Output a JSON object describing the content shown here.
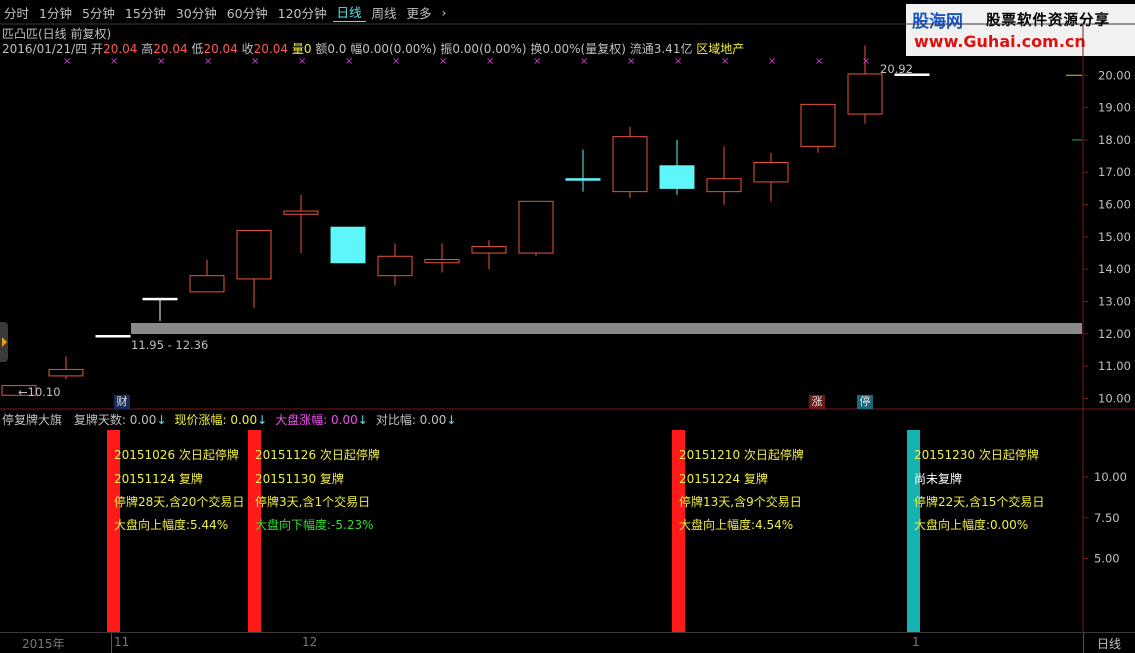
{
  "toolbar": {
    "tabs": [
      "分时",
      "1分钟",
      "5分钟",
      "15分钟",
      "30分钟",
      "60分钟",
      "120分钟",
      "日线",
      "周线",
      "更多"
    ],
    "active": "日线",
    "more_arrow": "›"
  },
  "logo": {
    "brand": "股海网",
    "slogan": "股票软件资源分享",
    "url": "www.Guhai.com.cn"
  },
  "stock": {
    "title": "匹凸匹(日线 前复权)",
    "date": "2016/01/21/四",
    "open_label": "开",
    "open": "20.04",
    "high_label": "高",
    "high": "20.04",
    "low_label": "低",
    "low": "20.04",
    "close_label": "收",
    "close": "20.04",
    "vol_label": "量",
    "vol": "0",
    "amt_label": "额",
    "amt": "0.0",
    "pct_label": "幅",
    "pct": "0.00(0.00%)",
    "amp_label": "振",
    "amp": "0.00(0.00%)",
    "turn_label": "换",
    "turn": "0.00%(量复权)",
    "float_label": "流通",
    "float": "3.41亿",
    "sector": "区域地产"
  },
  "price_axis": [
    "20.00",
    "19.00",
    "18.00",
    "17.00",
    "16.00",
    "15.00",
    "14.00",
    "13.00",
    "12.00",
    "11.00",
    "10.00"
  ],
  "annotations": {
    "low": "←10.10",
    "high": "20.92",
    "range": "11.95 - 12.36",
    "tag_cai": "财",
    "tag_zhang": "涨",
    "tag_ting": "停"
  },
  "chart_data": {
    "type": "candlestick",
    "ylim": [
      9.8,
      21.4
    ],
    "candles": [
      {
        "o": 10.1,
        "h": 10.3,
        "l": 10.1,
        "c": 10.4,
        "color": "#e8533c"
      },
      {
        "o": 10.7,
        "h": 11.3,
        "l": 10.6,
        "c": 10.9,
        "color": "#e8533c"
      },
      {
        "o": 11.95,
        "h": 11.95,
        "l": 11.95,
        "c": 11.95,
        "color": "#ffffff"
      },
      {
        "o": 13.1,
        "h": 13.1,
        "l": 12.4,
        "c": 13.1,
        "color": "#ffffff"
      },
      {
        "o": 13.3,
        "h": 14.3,
        "l": 13.3,
        "c": 13.8,
        "color": "#e8533c"
      },
      {
        "o": 13.7,
        "h": 15.2,
        "l": 12.8,
        "c": 15.2,
        "color": "#e8533c"
      },
      {
        "o": 15.7,
        "h": 16.3,
        "l": 14.5,
        "c": 15.8,
        "color": "#e8533c"
      },
      {
        "o": 15.3,
        "h": 15.3,
        "l": 14.2,
        "c": 14.2,
        "color": "#5ef6f8"
      },
      {
        "o": 14.4,
        "h": 14.8,
        "l": 13.5,
        "c": 13.8,
        "color": "#e8533c"
      },
      {
        "o": 14.2,
        "h": 14.8,
        "l": 13.9,
        "c": 14.3,
        "color": "#e8533c"
      },
      {
        "o": 14.5,
        "h": 14.9,
        "l": 14.0,
        "c": 14.7,
        "color": "#e8533c"
      },
      {
        "o": 14.5,
        "h": 16.1,
        "l": 14.4,
        "c": 16.1,
        "color": "#e8533c"
      },
      {
        "o": 16.8,
        "h": 17.7,
        "l": 16.4,
        "c": 16.8,
        "color": "#5ef6f8"
      },
      {
        "o": 16.4,
        "h": 18.4,
        "l": 16.2,
        "c": 18.1,
        "color": "#e8533c"
      },
      {
        "o": 17.2,
        "h": 18.0,
        "l": 16.3,
        "c": 16.5,
        "color": "#5ef6f8"
      },
      {
        "o": 16.4,
        "h": 17.8,
        "l": 16.0,
        "c": 16.8,
        "color": "#e8533c"
      },
      {
        "o": 16.7,
        "h": 17.6,
        "l": 16.1,
        "c": 17.3,
        "color": "#e8533c"
      },
      {
        "o": 17.8,
        "h": 19.1,
        "l": 17.6,
        "c": 19.1,
        "color": "#e8533c"
      },
      {
        "o": 18.8,
        "h": 20.92,
        "l": 18.5,
        "c": 20.04,
        "color": "#e8533c"
      },
      {
        "o": 20.04,
        "h": 20.04,
        "l": 20.04,
        "c": 20.04,
        "color": "#ffffff"
      }
    ]
  },
  "indicator": {
    "name": "停复牌大旗",
    "fields": [
      {
        "label": "复牌天数:",
        "value": "0.00",
        "color": "#c0c0c0"
      },
      {
        "label": "现价涨幅:",
        "value": "0.00",
        "color": "#f0f040"
      },
      {
        "label": "大盘涨幅:",
        "value": "0.00",
        "color": "#f050f0"
      },
      {
        "label": "对比幅:",
        "value": "0.00",
        "color": "#c0c0c0"
      }
    ],
    "arrow": "↓",
    "axis": [
      "10.00",
      "7.50",
      "5.00"
    ],
    "flags": [
      {
        "l1": "20151026 次日起停牌",
        "l2": "20151124 复牌",
        "l3": "停牌28天,含20个交易日",
        "l4": "大盘向上幅度:5.44%",
        "l2c": "#f0f040",
        "l4c": "#f0f040",
        "bar": "#ff1a1a"
      },
      {
        "l1": "20151126 次日起停牌",
        "l2": "20151130 复牌",
        "l3": "停牌3天,含1个交易日",
        "l4": "大盘向下幅度:-5.23%",
        "l2c": "#f0f040",
        "l4c": "#2ee02e",
        "bar": "#ff1a1a"
      },
      {
        "l1": "20151210 次日起停牌",
        "l2": "20151224 复牌",
        "l3": "停牌13天,含9个交易日",
        "l4": "大盘向上幅度:4.54%",
        "l2c": "#f0f040",
        "l4c": "#f0f040",
        "bar": "#ff1a1a"
      },
      {
        "l1": "20151230 次日起停牌",
        "l2": "尚未复牌",
        "l3": "停牌22天,含15个交易日",
        "l4": "大盘向上幅度:0.00%",
        "l2c": "#ffffff",
        "l4c": "#f0f040",
        "bar": "#17b3b3"
      }
    ]
  },
  "timeline": {
    "year": "2015年",
    "m11": "11",
    "m12": "12",
    "m1": "1",
    "period": "日线"
  }
}
